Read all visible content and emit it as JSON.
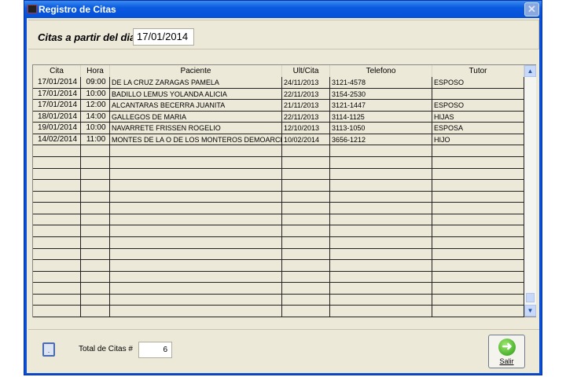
{
  "window": {
    "title": "Registro de Citas"
  },
  "filter": {
    "label": "Citas a partir del dia:",
    "date": "17/01/2014"
  },
  "grid": {
    "columns": [
      "Cita",
      "Hora",
      "Paciente",
      "Ult/Cita",
      "Telefono",
      "Tutor"
    ],
    "rows": [
      [
        "17/01/2014",
        "09:00",
        "DE LA CRUZ ZARAGAS PAMELA",
        "24/11/2013",
        "3121-4578",
        "ESPOSO"
      ],
      [
        "17/01/2014",
        "10:00",
        "BADILLO LEMUS YOLANDA ALICIA",
        "22/11/2013",
        "3154-2530",
        ""
      ],
      [
        "17/01/2014",
        "12:00",
        "ALCANTARAS BECERRA JUANITA",
        "21/11/2013",
        "3121-1447",
        "ESPOSO"
      ],
      [
        "18/01/2014",
        "14:00",
        "GALLEGOS DE MARIA",
        "22/11/2013",
        "3114-1125",
        "HIJAS"
      ],
      [
        "19/01/2014",
        "10:00",
        "NAVARRETE FRISSEN ROGELIO",
        "12/10/2013",
        "3113-1050",
        "ESPOSA"
      ],
      [
        "14/02/2014",
        "11:00",
        "MONTES DE LA O DE LOS MONTEROS DEMOARCHIVAL",
        "10/02/2014",
        "3656-1212",
        "HIJO"
      ]
    ],
    "empty_rows": 15
  },
  "footer": {
    "small_button": ".",
    "total_label": "Total de Citas #",
    "total_value": "6",
    "exit_label": "Salir"
  },
  "icons": {
    "close": "close-icon",
    "exit": "arrow-right-icon",
    "scroll_up": "chevron-up-icon",
    "scroll_down": "chevron-down-icon"
  }
}
